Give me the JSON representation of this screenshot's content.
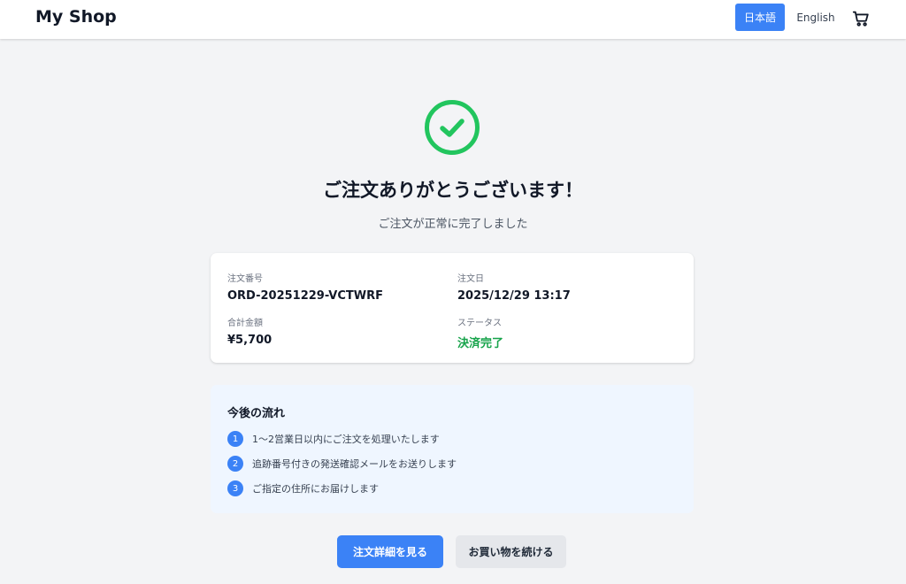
{
  "header": {
    "logo": "My Shop",
    "lang_ja": "日本語",
    "lang_en": "English",
    "cart_icon": "cart-icon"
  },
  "confirmation": {
    "icon": "check-circle-icon",
    "title": "ご注文ありがとうございます！",
    "subtitle": "ご注文が正常に完了しました"
  },
  "order": {
    "number_label": "注文番号",
    "number_value": "ORD-20251229-VCTWRF",
    "date_label": "注文日",
    "date_value": "2025/12/29 13:17",
    "total_label": "合計金額",
    "total_value": "¥5,700",
    "status_label": "ステータス",
    "status_value": "決済完了"
  },
  "next_steps": {
    "title": "今後の流れ",
    "steps": [
      {
        "num": "1",
        "text": "1〜2営業日以内にご注文を処理いたします"
      },
      {
        "num": "2",
        "text": "追跡番号付きの発送確認メールをお送りします"
      },
      {
        "num": "3",
        "text": "ご指定の住所にお届けします"
      }
    ]
  },
  "actions": {
    "view_details": "注文詳細を見る",
    "continue_shopping": "お買い物を続ける"
  },
  "colors": {
    "accent": "#3b82f6",
    "success": "#16a34a",
    "success_icon": "#22c55e",
    "panel_bg": "#eff6ff",
    "page_bg": "#f3f4f6"
  }
}
